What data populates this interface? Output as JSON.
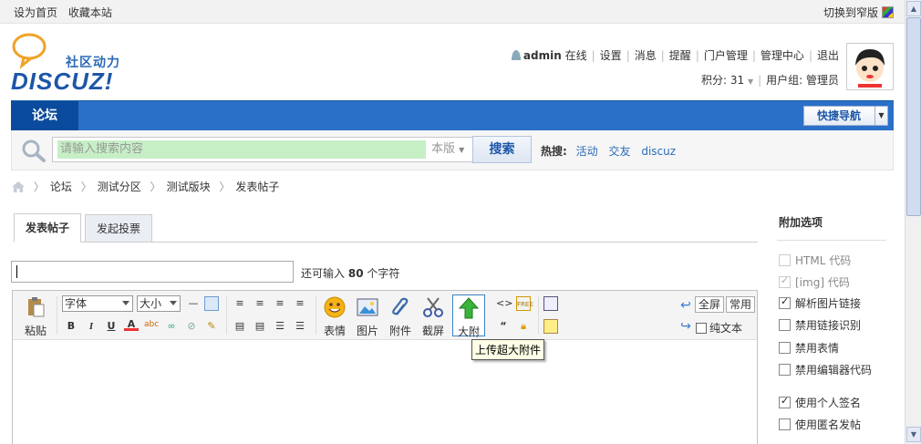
{
  "topbar": {
    "set_home": "设为首页",
    "bookmark": "收藏本站",
    "switch_width": "切换到窄版"
  },
  "logo": {
    "cn": "社区动力",
    "en": "DISCUZ!"
  },
  "user": {
    "name": "admin",
    "status": "在线",
    "links": [
      "设置",
      "消息",
      "提醒",
      "门户管理",
      "管理中心",
      "退出"
    ],
    "points_label": "积分: 31",
    "group_label": "用户组: 管理员"
  },
  "nav": {
    "forum_tab": "论坛",
    "quick_nav": "快捷导航"
  },
  "search": {
    "placeholder": "请输入搜索内容",
    "scope": "本版",
    "button": "搜索",
    "hot_label": "热搜:",
    "hot_items": [
      "活动",
      "交友",
      "discuz"
    ]
  },
  "breadcrumb": [
    "论坛",
    "测试分区",
    "测试版块",
    "发表帖子"
  ],
  "tabs": [
    "发表帖子",
    "发起投票"
  ],
  "subject": {
    "remain_prefix": "还可输入",
    "remain_count": "80",
    "remain_suffix": "个字符"
  },
  "editor": {
    "paste": "粘贴",
    "font": "字体",
    "size": "大小",
    "emoji": "表情",
    "image": "图片",
    "attach": "附件",
    "screenshot": "截屏",
    "bigattach": "大附",
    "fullscreen": "全屏",
    "common": "常用",
    "plaintext": "纯文本",
    "tooltip": "上传超大附件"
  },
  "side": {
    "title": "附加选项",
    "options": [
      {
        "label": "HTML 代码",
        "checked": false,
        "disabled": true
      },
      {
        "label": "[img] 代码",
        "checked": true,
        "disabled": true
      },
      {
        "label": "解析图片链接",
        "checked": true,
        "disabled": false
      },
      {
        "label": "禁用链接识别",
        "checked": false,
        "disabled": false
      },
      {
        "label": "禁用表情",
        "checked": false,
        "disabled": false
      },
      {
        "label": "禁用编辑器代码",
        "checked": false,
        "disabled": false
      },
      {
        "label": "使用个人签名",
        "checked": true,
        "disabled": false
      },
      {
        "label": "使用匿名发帖",
        "checked": false,
        "disabled": false
      }
    ]
  },
  "colors": {
    "nav_blue": "#2b70c8",
    "nav_active": "#0a4b9d",
    "link_blue": "#2b6bb7",
    "search_green": "#c6efc6"
  }
}
